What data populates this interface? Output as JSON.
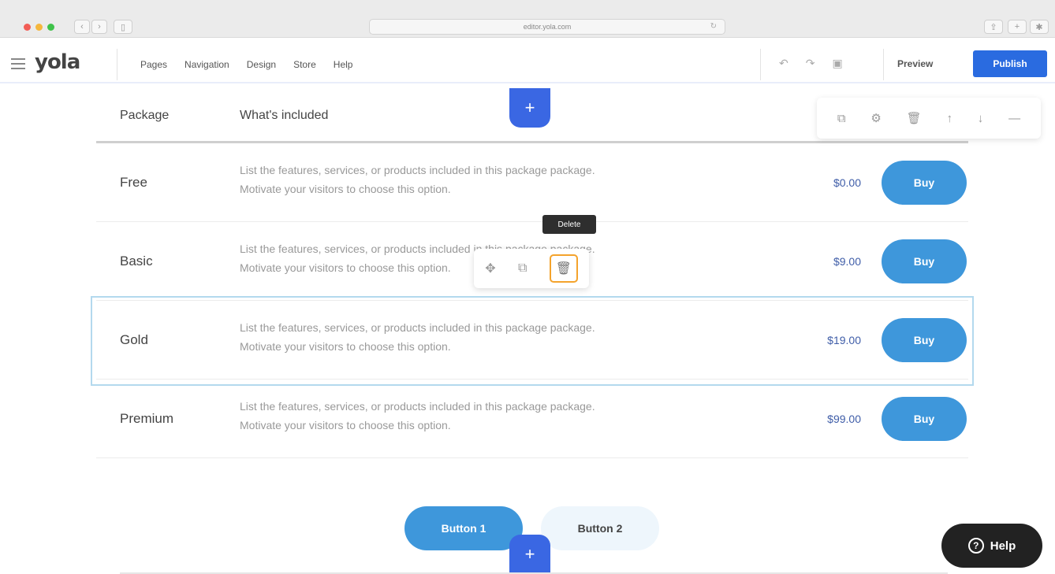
{
  "browser": {
    "url": "editor.yola.com",
    "back_icon": "chevron-left-icon",
    "forward_icon": "chevron-right-icon",
    "sidebar_icon": "sidebar-icon",
    "reload_icon": "reload-icon",
    "right_icons": [
      "share-icon",
      "new-tab-icon",
      "extensions-icon"
    ]
  },
  "toolbar": {
    "logo": "yola",
    "menu": [
      "Pages",
      "Navigation",
      "Design",
      "Store",
      "Help"
    ],
    "undo_icon": "undo-icon",
    "redo_icon": "redo-icon",
    "save_icon": "save-icon",
    "preview_label": "Preview",
    "publish_label": "Publish",
    "accent_color": "#2a6be0"
  },
  "table": {
    "headers": {
      "package": "Package",
      "included": "What's included"
    },
    "rows": [
      {
        "name": "Free",
        "desc_line1": "List the features, services, or products included in this package package.",
        "desc_line2": "Motivate your visitors to choose this option.",
        "price": "$0.00",
        "buy": "Buy"
      },
      {
        "name": "Basic",
        "desc_line1": "List the features, services, or products included in this package package.",
        "desc_line2": "Motivate your visitors to choose this option.",
        "price": "$9.00",
        "buy": "Buy"
      },
      {
        "name": "Gold",
        "desc_line1": "List the features, services, or products included in this package package.",
        "desc_line2": "Motivate your visitors to choose this option.",
        "price": "$19.00",
        "buy": "Buy"
      },
      {
        "name": "Premium",
        "desc_line1": "List the features, services, or products included in this package package.",
        "desc_line2": "Motivate your visitors to choose this option.",
        "price": "$99.00",
        "buy": "Buy"
      }
    ]
  },
  "block_tools": [
    "duplicate-icon",
    "settings-icon",
    "delete-icon",
    "move-up-icon",
    "move-down-icon",
    "more-icon"
  ],
  "row_tools": {
    "tooltip": "Delete",
    "icons": [
      "move-icon",
      "duplicate-icon",
      "delete-icon"
    ]
  },
  "buttons": {
    "button1": "Button 1",
    "button2": "Button 2"
  },
  "help": {
    "label": "Help",
    "icon": "help-circle-icon"
  }
}
